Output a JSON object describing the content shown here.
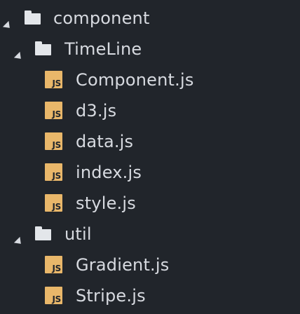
{
  "tree": {
    "root": {
      "label": "component",
      "expanded": true,
      "icon": "folder-icon"
    },
    "timeline_folder": {
      "label": "TimeLine",
      "expanded": true,
      "icon": "folder-icon"
    },
    "timeline_files": [
      {
        "label": "Component.js",
        "icon_text": "JS"
      },
      {
        "label": "d3.js",
        "icon_text": "JS"
      },
      {
        "label": "data.js",
        "icon_text": "JS"
      },
      {
        "label": "index.js",
        "icon_text": "JS"
      },
      {
        "label": "style.js",
        "icon_text": "JS"
      }
    ],
    "util_folder": {
      "label": "util",
      "expanded": true,
      "icon": "folder-icon"
    },
    "util_files": [
      {
        "label": "Gradient.js",
        "icon_text": "JS"
      },
      {
        "label": "Stripe.js",
        "icon_text": "JS"
      }
    ]
  },
  "colors": {
    "background": "#21252b",
    "text": "#d7dae0",
    "folder": "#e3e6ea",
    "js_badge": "#e9b76a"
  }
}
